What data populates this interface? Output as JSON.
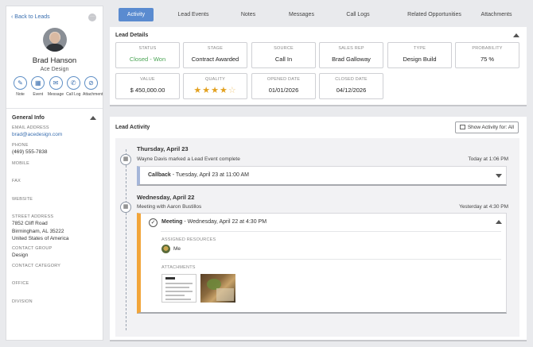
{
  "left": {
    "back_label": "Back to Leads",
    "menu_label": "···",
    "name": "Brad Hanson",
    "company": "Ace Design",
    "actions": [
      {
        "label": "Note",
        "icon": "✎"
      },
      {
        "label": "Event",
        "icon": "▦"
      },
      {
        "label": "Message",
        "icon": "✉"
      },
      {
        "label": "Call Log",
        "icon": "✆"
      },
      {
        "label": "Attachment",
        "icon": "⊘"
      }
    ],
    "general_info_title": "General Info",
    "fields": {
      "email_label": "EMAIL ADDRESS",
      "email_value": "brad@acedesign.com",
      "phone_label": "PHONE",
      "phone_value": "(469) 555-7838",
      "mobile_label": "MOBILE",
      "fax_label": "FAX",
      "website_label": "WEBSITE",
      "street_label": "STREET ADDRESS",
      "street_line1": "7852 Cliff Road",
      "street_line2": "Birmingham, AL 35222",
      "street_line3": "United States of America",
      "contact_group_label": "CONTACT GROUP",
      "contact_group_value": "Design",
      "contact_category_label": "CONTACT CATEGORY",
      "office_label": "OFFICE",
      "division_label": "DIVISION"
    }
  },
  "tabs": [
    "Activity",
    "Lead Events",
    "Notes",
    "Messages",
    "Call Logs",
    "Related Opportunities",
    "Attachments"
  ],
  "details": {
    "title": "Lead Details",
    "status_label": "STATUS",
    "status_value": "Closed - Won",
    "stage_label": "STAGE",
    "stage_value": "Contract Awarded",
    "source_label": "SOURCE",
    "source_value": "Call In",
    "rep_label": "SALES REP",
    "rep_value": "Brad Galloway",
    "type_label": "TYPE",
    "type_value": "Design Build",
    "prob_label": "PROBABILITY",
    "prob_value": "75 %",
    "value_label": "VALUE",
    "value_value": "$ 450,000.00",
    "quality_label": "QUALITY",
    "quality_rating": 4,
    "quality_max": 5,
    "opened_label": "OPENED DATE",
    "opened_value": "01/01/2026",
    "closed_label": "CLOSED DATE",
    "closed_value": "04/12/2026"
  },
  "activity": {
    "title": "Lead Activity",
    "show_button": "Show Activity for: All",
    "day1": "Thursday, April 23",
    "ev1_text": "Wayne Davis marked a Lead Event complete",
    "ev1_time": "Today at 1:06 PM",
    "ev1_card_title": "Callback",
    "ev1_card_detail": " - Tuesday, April 23 at 11:00 AM",
    "day2": "Wednesday, April 22",
    "ev2_text": "Meeting with Aaron Bustillos",
    "ev2_time": "Yesterday at 4:30 PM",
    "ev2_card_title": "Meeting",
    "ev2_card_detail": " - Wednesday, April 22 at 4:30 PM",
    "assigned_label": "ASSIGNED RESOURCES",
    "assigned_name": "Me",
    "attachments_label": "ATTACHMENTS"
  },
  "colors": {
    "accent": "#5a8bd0",
    "link": "#3a6fb0",
    "won": "#4aa454",
    "star": "#e3a120",
    "meeting_bar": "#f2a53a",
    "callback_bar": "#a5b6d9"
  }
}
